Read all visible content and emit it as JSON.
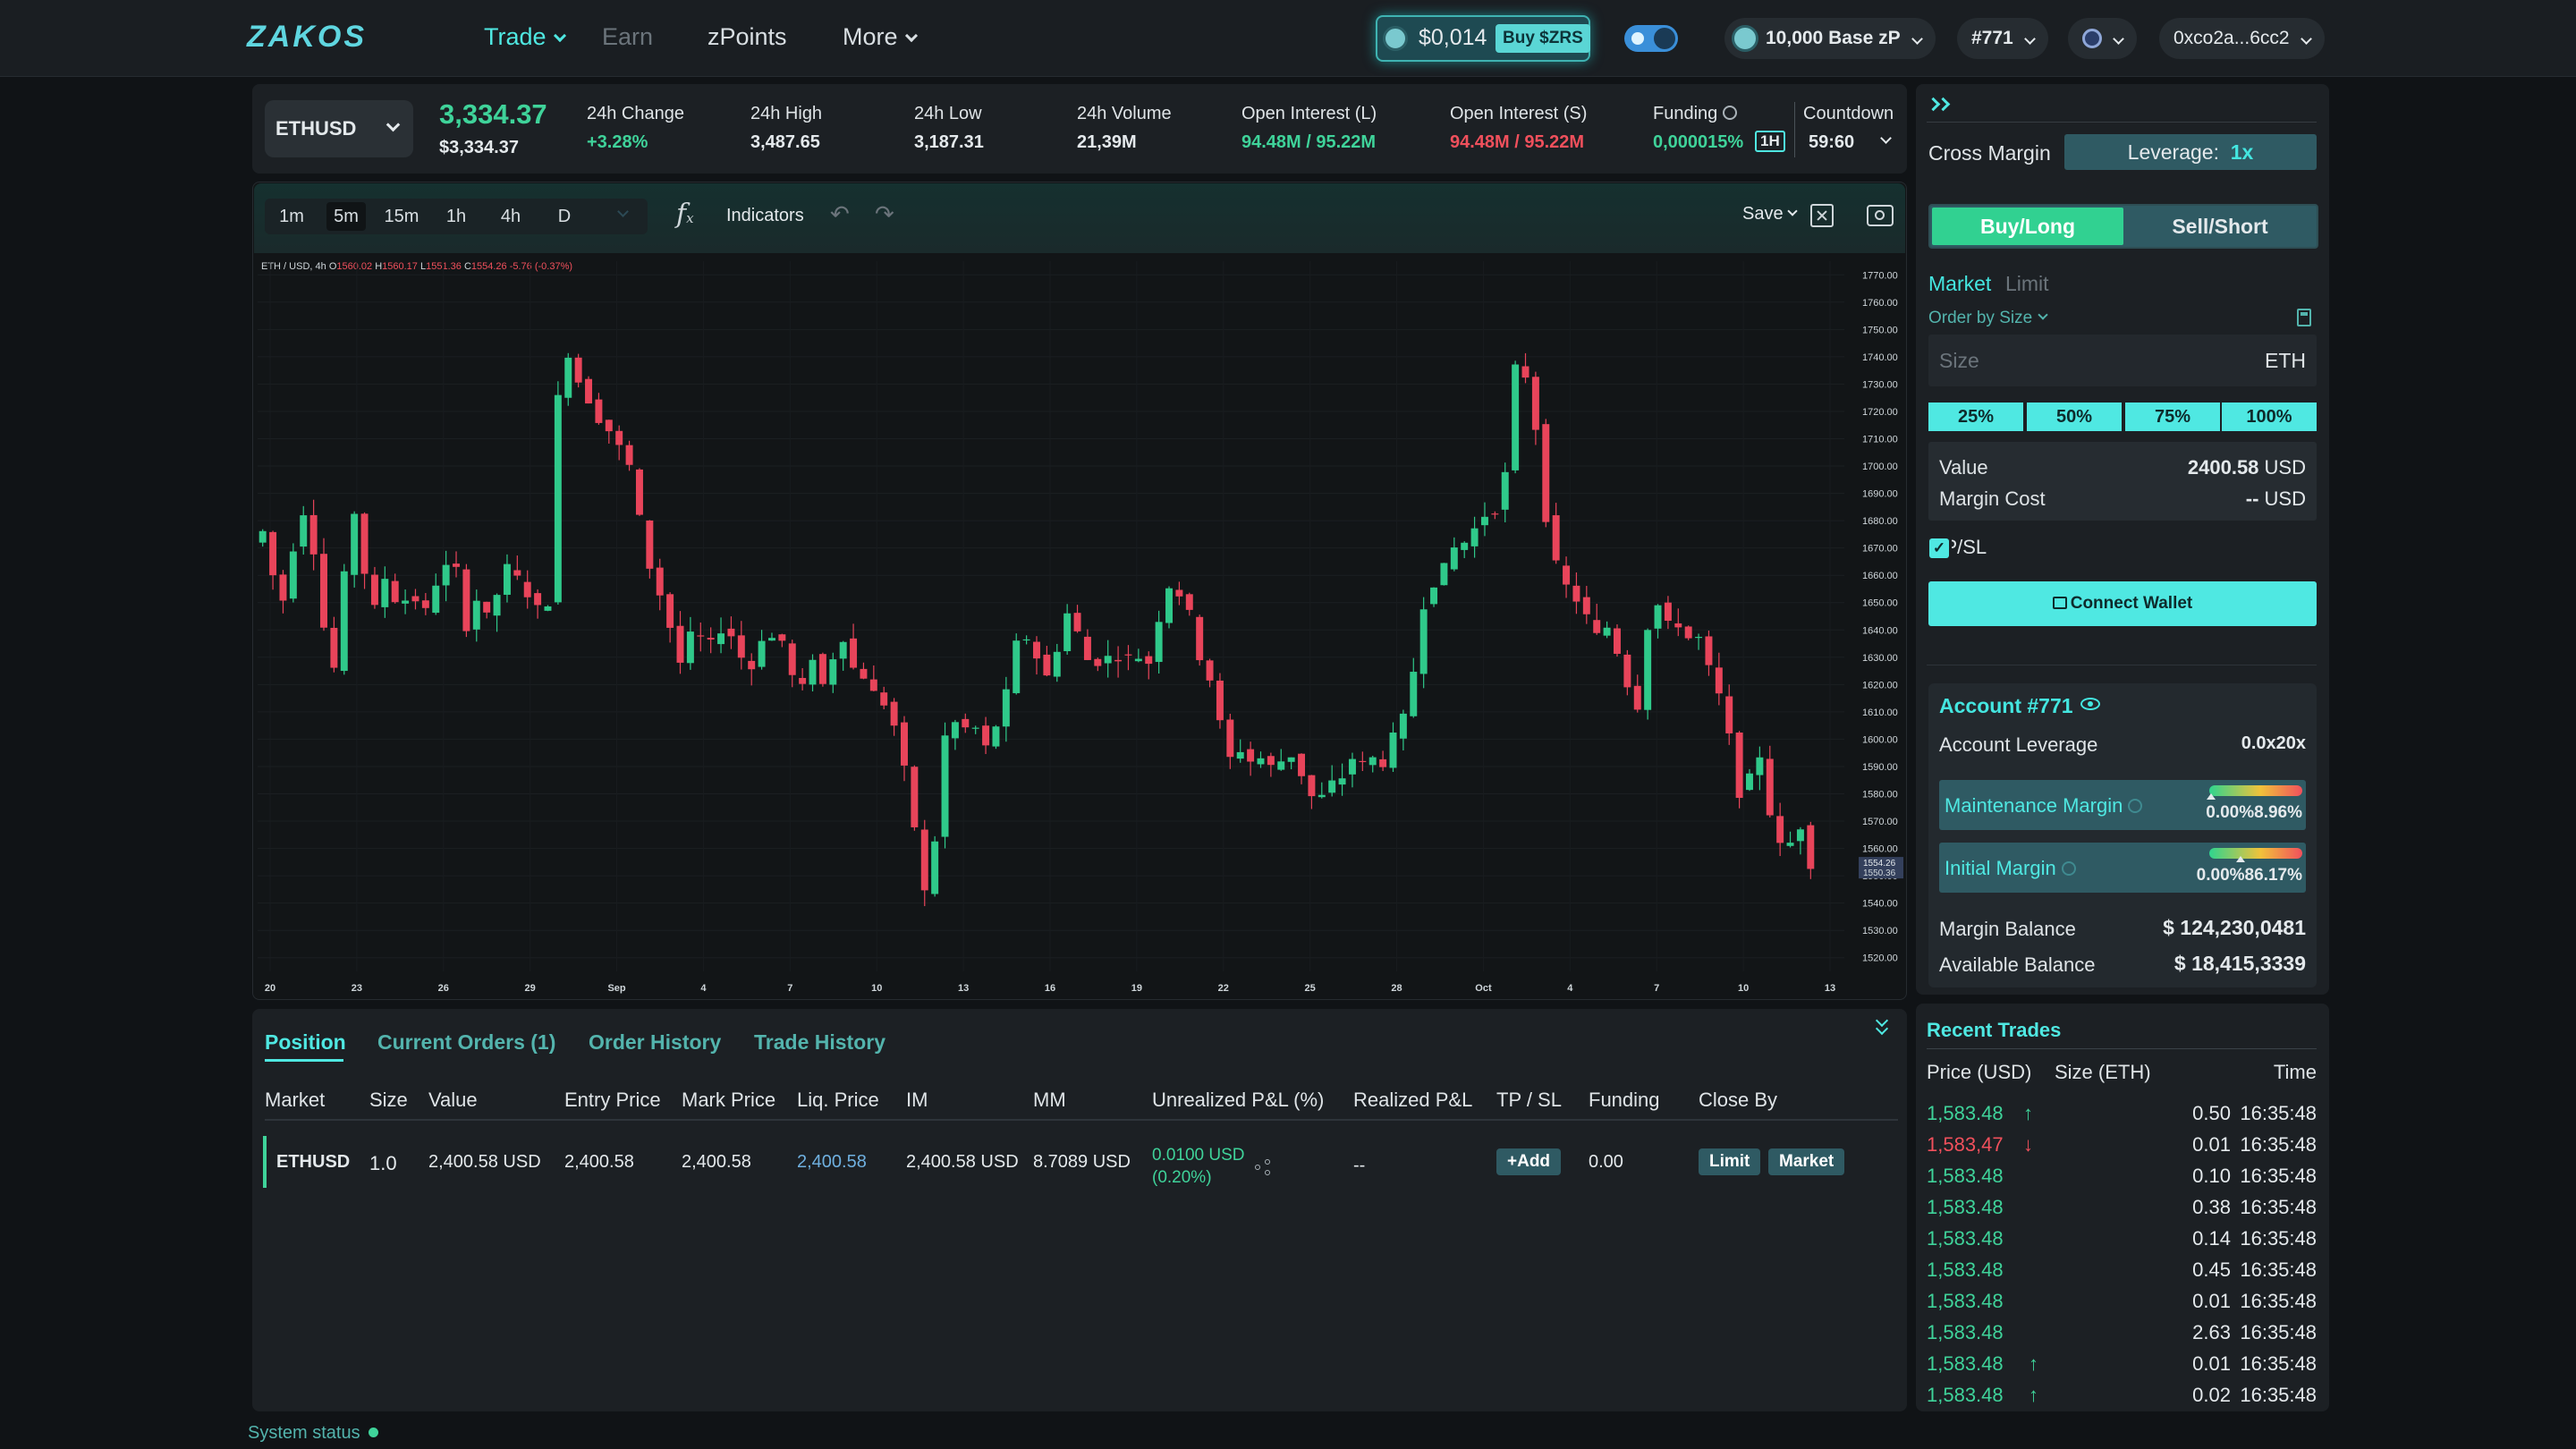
{
  "nav": {
    "logo": "ZAKOS",
    "trade": "Trade",
    "earn": "Earn",
    "zpoints": "zPoints",
    "more": "More",
    "token_price": "$0,014",
    "buy_label": "Buy $ZRS",
    "balance": "10,000 Base zP",
    "account": "#771",
    "wallet": "0xco2a...6cc2"
  },
  "ticker": {
    "market": "ETHUSD",
    "price": "3,334.37",
    "price_usd": "$3,334.37",
    "stats": [
      {
        "label": "24h Change",
        "value": "+3.28%",
        "tone": "grn"
      },
      {
        "label": "24h High",
        "value": "3,487.65",
        "tone": "ink"
      },
      {
        "label": "24h Low",
        "value": "3,187.31",
        "tone": "ink"
      },
      {
        "label": "24h Volume",
        "value": "21,39M",
        "tone": "ink"
      },
      {
        "label": "Open Interest (L)",
        "value": "94.48M / 95.22M",
        "tone": "grn"
      },
      {
        "label": "Open Interest (S)",
        "value": "94.48M / 95.22M",
        "tone": "red"
      },
      {
        "label": "Funding",
        "value": "0,000015%",
        "tone": "grn"
      },
      {
        "label": "Countdown",
        "value": "59:60",
        "tone": "ink"
      }
    ],
    "funding_interval": "1H"
  },
  "toolbar": {
    "timeframes": [
      "1m",
      "5m",
      "15m",
      "1h",
      "4h",
      "D"
    ],
    "active_timeframe": "5m",
    "indicators": "Indicators",
    "save": "Save"
  },
  "chart_data": {
    "type": "candlestick",
    "legend_symbol": "ETH / USD, 4h",
    "legend_ohlc": {
      "O": "1560.02",
      "H": "1560.17",
      "L": "1551.36",
      "C": "1554.26",
      "change": "-5.76 (-0.37%)"
    },
    "ylim": [
      1515,
      1775
    ],
    "y_ticks": [
      "1770.00",
      "1760.00",
      "1750.00",
      "1740.00",
      "1730.00",
      "1720.00",
      "1710.00",
      "1700.00",
      "1690.00",
      "1680.00",
      "1670.00",
      "1660.00",
      "1650.00",
      "1640.00",
      "1630.00",
      "1620.00",
      "1610.00",
      "1600.00",
      "1590.00",
      "1580.00",
      "1570.00",
      "1560.00",
      "1550.00",
      "1540.00",
      "1530.00",
      "1520.00"
    ],
    "x_ticks": [
      "20",
      "23",
      "26",
      "29",
      "Sep",
      "4",
      "7",
      "10",
      "13",
      "16",
      "19",
      "22",
      "25",
      "28",
      "Oct",
      "4",
      "7",
      "10",
      "13"
    ],
    "last_price_label": "1554.26",
    "last_price_sub": "1550.36",
    "close_path": [
      1672,
      1676,
      1660,
      1651,
      1670,
      1683,
      1669,
      1641,
      1626,
      1660,
      1683,
      1661,
      1648,
      1659,
      1651,
      1651,
      1651,
      1647,
      1657,
      1663,
      1662,
      1641,
      1651,
      1645,
      1653,
      1663,
      1659,
      1653,
      1648,
      1650,
      1725,
      1741,
      1731,
      1724,
      1717,
      1713,
      1707,
      1700,
      1681,
      1663,
      1653,
      1641,
      1628,
      1638,
      1637,
      1635,
      1640,
      1638,
      1630,
      1626,
      1637,
      1637,
      1636,
      1623,
      1619,
      1630,
      1620,
      1630,
      1637,
      1626,
      1623,
      1617,
      1613,
      1605,
      1589,
      1568,
      1544,
      1563,
      1601,
      1606,
      1604,
      1604,
      1597,
      1605,
      1617,
      1635,
      1637,
      1630,
      1623,
      1633,
      1646,
      1639,
      1629,
      1628,
      1630,
      1630,
      1630,
      1630,
      1628,
      1644,
      1656,
      1653,
      1646,
      1630,
      1622,
      1606,
      1593,
      1596,
      1592,
      1593,
      1590,
      1592,
      1594,
      1587,
      1579,
      1579,
      1584,
      1586,
      1593,
      1591,
      1593,
      1591,
      1601,
      1608,
      1625,
      1649,
      1657,
      1663,
      1670,
      1672,
      1677,
      1682,
      1684,
      1697,
      1736,
      1733,
      1714,
      1681,
      1664,
      1656,
      1651,
      1645,
      1638,
      1641,
      1632,
      1620,
      1612,
      1641,
      1649,
      1642,
      1642,
      1637,
      1637,
      1626,
      1616,
      1601,
      1580,
      1586,
      1594,
      1573,
      1561,
      1562,
      1568,
      1554
    ]
  },
  "positions": {
    "tabs": [
      "Position",
      "Current Orders (1)",
      "Order History",
      "Trade History"
    ],
    "headers": [
      "Market",
      "Size",
      "Value",
      "Entry Price",
      "Mark Price",
      "Liq. Price",
      "IM",
      "MM",
      "Unrealized P&L (%)",
      "Realized P&L",
      "TP / SL",
      "Funding",
      "Close By"
    ],
    "row": {
      "market": "ETHUSD",
      "size": "1.0",
      "value": "2,400.58 USD",
      "entry": "2,400.58",
      "mark": "2,400.58",
      "liq": "2,400.58",
      "im": "2,400.58 USD",
      "mm": "8.7089 USD",
      "upnl": "0.0100 USD",
      "upnl_pct": "(0.20%)",
      "rpnl": "--",
      "tpsl": "+Add",
      "funding": "0.00",
      "close_limit": "Limit",
      "close_market": "Market"
    }
  },
  "order": {
    "cross_margin": "Cross Margin",
    "leverage_label": "Leverage:",
    "leverage_value": "1x",
    "buy": "Buy/Long",
    "sell": "Sell/Short",
    "market": "Market",
    "limit": "Limit",
    "order_by": "Order by Size",
    "size_placeholder": "Size",
    "size_unit": "ETH",
    "percents": [
      "25%",
      "50%",
      "75%",
      "100%"
    ],
    "value_label": "Value",
    "value": "2400.58",
    "value_unit": "USD",
    "margin_cost_label": "Margin Cost",
    "margin_cost": "--",
    "margin_cost_unit": "USD",
    "tpsl": "TP/SL",
    "connect": "Connect Wallet"
  },
  "account": {
    "title": "Account #771",
    "leverage_label": "Account Leverage",
    "leverage_value": "0.0x20x",
    "maint_label": "Maintenance Margin",
    "maint_value": "0.00%8.96%",
    "maint_fraction": 0.02,
    "init_label": "Initial Margin",
    "init_value": "0.00%86.17%",
    "init_fraction": 0.34,
    "margin_balance_label": "Margin Balance",
    "margin_balance": "$ 124,230,0481",
    "available_label": "Available Balance",
    "available": "$ 18,415,3339"
  },
  "trades": {
    "title": "Recent Trades",
    "headers": [
      "Price (USD)",
      "Size (ETH)",
      "Time"
    ],
    "rows": [
      {
        "price": "1,583.48",
        "dir": "up",
        "size": "0.50",
        "time": "16:35:48"
      },
      {
        "price": "1,583,47",
        "dir": "down",
        "size": "0.01",
        "time": "16:35:48"
      },
      {
        "price": "1,583.48",
        "dir": "",
        "size": "0.10",
        "time": "16:35:48"
      },
      {
        "price": "1,583.48",
        "dir": "",
        "size": "0.38",
        "time": "16:35:48"
      },
      {
        "price": "1,583.48",
        "dir": "",
        "size": "0.14",
        "time": "16:35:48"
      },
      {
        "price": "1,583.48",
        "dir": "",
        "size": "0.45",
        "time": "16:35:48"
      },
      {
        "price": "1,583.48",
        "dir": "",
        "size": "0.01",
        "time": "16:35:48"
      },
      {
        "price": "1,583.48",
        "dir": "",
        "size": "2.63",
        "time": "16:35:48"
      },
      {
        "price": "1,583.48",
        "dir": "up",
        "size": "0.01",
        "time": "16:35:48"
      },
      {
        "price": "1,583.48",
        "dir": "up",
        "size": "0.02",
        "time": "16:35:48"
      }
    ]
  },
  "status": {
    "label": "System status"
  },
  "colors": {
    "accent": "#4fe8e2",
    "up": "#3fd39a",
    "down": "#f0505c",
    "bg": "#101316",
    "panel": "#1c2024"
  }
}
